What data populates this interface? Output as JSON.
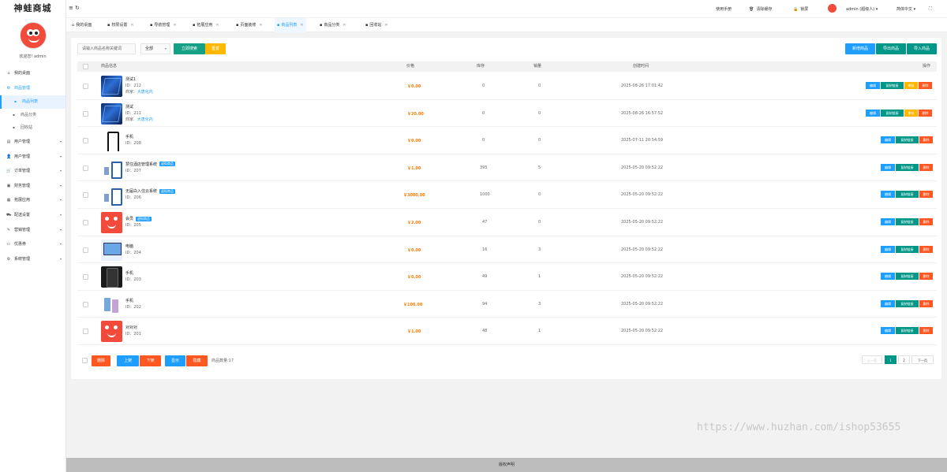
{
  "app": {
    "logo": "神蛙商城",
    "welcome": "欢迎您! admin"
  },
  "sidebar": {
    "items": [
      {
        "label": "我的桌面",
        "icon": "home-icon"
      },
      {
        "label": "商品管理",
        "icon": "gear-icon",
        "open": true
      },
      {
        "label": "用户管理",
        "icon": "document-icon"
      },
      {
        "label": "用户管理",
        "icon": "user-icon"
      },
      {
        "label": "订单管理",
        "icon": "cart-icon"
      },
      {
        "label": "财务管理",
        "icon": "wallet-icon"
      },
      {
        "label": "拓展应用",
        "icon": "app-grid-icon"
      },
      {
        "label": "配送设置",
        "icon": "truck-icon"
      },
      {
        "label": "营销管理",
        "icon": "marketing-icon"
      },
      {
        "label": "优惠券",
        "icon": "coupon-icon"
      },
      {
        "label": "系统管理",
        "icon": "settings-icon"
      }
    ],
    "sub_items": [
      {
        "label": "商品列表",
        "active": true
      },
      {
        "label": "商品分类"
      },
      {
        "label": "回收站"
      }
    ]
  },
  "header": {
    "menu_icon": "≡",
    "refresh_icon": "↻",
    "manual": "使用手册",
    "clear_cache": "清除缓存",
    "lock": "锁屏",
    "user": "admin (超级人)",
    "lang": "简体中文",
    "fullscreen": "⛶"
  },
  "tabs": [
    {
      "label": "我的桌面",
      "closable": false
    },
    {
      "label": "权限设置",
      "closable": true
    },
    {
      "label": "导航管理",
      "closable": true
    },
    {
      "label": "拓展应用",
      "closable": true
    },
    {
      "label": "页面装修",
      "closable": true
    },
    {
      "label": "商品列表",
      "closable": true,
      "active": true
    },
    {
      "label": "商品分类",
      "closable": true
    },
    {
      "label": "回收站",
      "closable": true
    }
  ],
  "toolbar": {
    "search_placeholder": "请输入商品名称关键词",
    "select_value": "全部",
    "search_btn": "立即搜索",
    "reset_btn": "重置",
    "add_btn": "新增商品",
    "export_btn": "导出商品",
    "import_btn": "导入商品"
  },
  "table": {
    "headers": {
      "info": "商品信息",
      "price": "价格",
      "stock": "库存",
      "sales": "销量",
      "created": "创建时间",
      "actions": "操作"
    },
    "id_prefix": "ID：",
    "merchant_label": "商家:",
    "virtual_badge": "虚拟商品",
    "rows": [
      {
        "name": "测试1",
        "id": "212",
        "merchant": "大唐化内",
        "price": "￥0.00",
        "stock": "0",
        "sales": "0",
        "created": "2025-08-26 17:01:42",
        "thumb": "city",
        "extra_action": "审核"
      },
      {
        "name": "测试",
        "id": "211",
        "merchant": "大唐化内",
        "price": "￥20.00",
        "stock": "0",
        "sales": "0",
        "created": "2025-08-26 16:57:52",
        "thumb": "city",
        "extra_action": "审核"
      },
      {
        "name": "手机",
        "id": "208",
        "price": "￥0.00",
        "stock": "0",
        "sales": "0",
        "created": "2025-07-11 20:54:59",
        "thumb": "phone"
      },
      {
        "name": "慧住酒店管理系统",
        "id": "207",
        "virtual": true,
        "price": "￥1.00",
        "stock": "395",
        "sales": "5",
        "created": "2025-05-20 09:52:22",
        "thumb": "hotel"
      },
      {
        "name": "无届白入住云系统",
        "id": "206",
        "virtual": true,
        "price": "￥3000.00",
        "stock": "1000",
        "sales": "0",
        "created": "2025-05-20 09:52:22",
        "thumb": "hotel"
      },
      {
        "name": "会员",
        "id": "205",
        "virtual": true,
        "price": "￥2.00",
        "stock": "47",
        "sales": "0",
        "created": "2025-05-20 09:52:22",
        "thumb": "frog"
      },
      {
        "name": "电脑",
        "id": "204",
        "price": "￥0.00",
        "stock": "16",
        "sales": "3",
        "created": "2025-05-20 09:52:22",
        "thumb": "pc"
      },
      {
        "name": "手机",
        "id": "203",
        "price": "￥0.00",
        "stock": "49",
        "sales": "1",
        "created": "2025-05-20 09:52:22",
        "thumb": "phonedark"
      },
      {
        "name": "手机",
        "id": "202",
        "price": "￥100.00",
        "stock": "94",
        "sales": "3",
        "created": "2025-05-20 09:52:22",
        "thumb": "phonegroup"
      },
      {
        "name": "对对对",
        "id": "201",
        "price": "￥1.00",
        "stock": "48",
        "sales": "1",
        "created": "2025-05-20 09:52:22",
        "thumb": "frog"
      }
    ],
    "row_actions": {
      "edit": "编辑",
      "copy": "复制链接",
      "delete": "删除"
    }
  },
  "bulk": {
    "delete": "删除",
    "up": "上架",
    "down": "下架",
    "show": "显示",
    "hide": "隐藏",
    "count_label": "商品数量:17"
  },
  "pager": {
    "prev": "上一页",
    "pages": [
      "1",
      "2"
    ],
    "current": "1",
    "next": "下一页"
  },
  "footer": {
    "text": "版权声明"
  },
  "watermark": "https://www.huzhan.com/ishop53655",
  "colors": {
    "primary": "#1e9fff",
    "teal": "#009688",
    "green": "#16a085",
    "orange": "#ffb800",
    "red": "#ff5722",
    "price": "#ff7a00"
  }
}
